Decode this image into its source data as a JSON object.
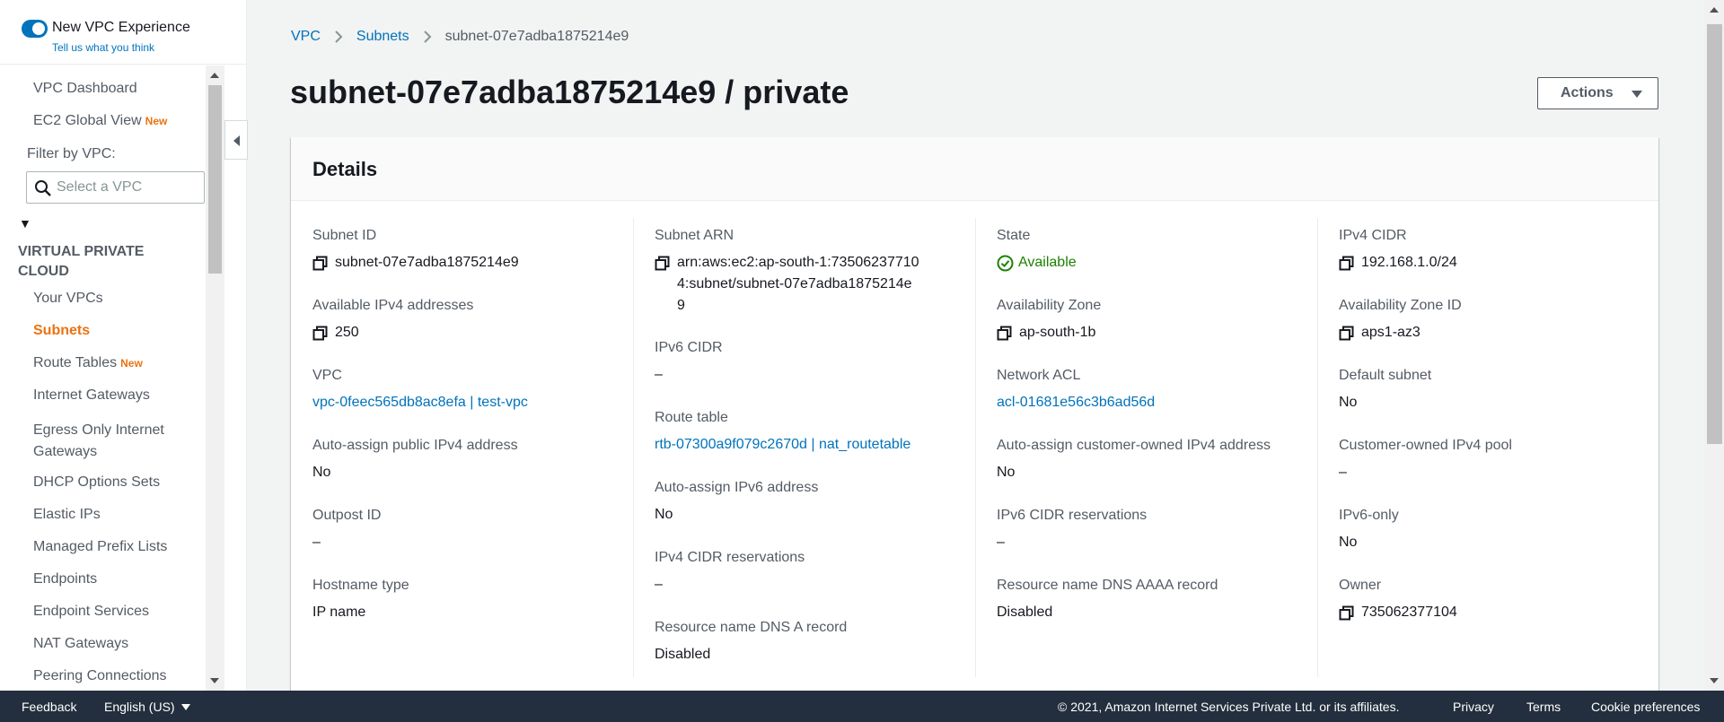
{
  "sidebar": {
    "toggle_label": "New VPC Experience",
    "toggle_sub": "Tell us what you think",
    "top_links": [
      {
        "label": "VPC Dashboard",
        "badge": ""
      },
      {
        "label": "EC2 Global View",
        "badge": "New"
      }
    ],
    "filter_label": "Filter by VPC:",
    "filter_placeholder": "Select a VPC",
    "section_title": "VIRTUAL PRIVATE CLOUD",
    "items": [
      {
        "label": "Your VPCs",
        "badge": ""
      },
      {
        "label": "Subnets",
        "badge": "",
        "active": true
      },
      {
        "label": "Route Tables",
        "badge": "New"
      },
      {
        "label": "Internet Gateways",
        "badge": ""
      },
      {
        "label": "Egress Only Internet Gateways",
        "badge": ""
      },
      {
        "label": "DHCP Options Sets",
        "badge": ""
      },
      {
        "label": "Elastic IPs",
        "badge": ""
      },
      {
        "label": "Managed Prefix Lists",
        "badge": ""
      },
      {
        "label": "Endpoints",
        "badge": ""
      },
      {
        "label": "Endpoint Services",
        "badge": ""
      },
      {
        "label": "NAT Gateways",
        "badge": ""
      },
      {
        "label": "Peering Connections",
        "badge": ""
      }
    ]
  },
  "breadcrumb": [
    "VPC",
    "Subnets",
    "subnet-07e7adba1875214e9"
  ],
  "page_title": "subnet-07e7adba1875214e9 / private",
  "actions_label": "Actions",
  "details": {
    "title": "Details",
    "columns": [
      [
        {
          "label": "Subnet ID",
          "value": "subnet-07e7adba1875214e9",
          "kind": "copy"
        },
        {
          "label": "Available IPv4 addresses",
          "value": "250",
          "kind": "copy"
        },
        {
          "label": "VPC",
          "value": "vpc-0feec565db8ac8efa | test-vpc",
          "kind": "link"
        },
        {
          "label": "Auto-assign public IPv4 address",
          "value": "No",
          "kind": "text"
        },
        {
          "label": "Outpost ID",
          "value": "–",
          "kind": "text"
        },
        {
          "label": "Hostname type",
          "value": "IP name",
          "kind": "text"
        }
      ],
      [
        {
          "label": "Subnet ARN",
          "value": "arn:aws:ec2:ap-south-1:735062377104:subnet/subnet-07e7adba1875214e9",
          "kind": "copy"
        },
        {
          "label": "IPv6 CIDR",
          "value": "–",
          "kind": "text"
        },
        {
          "label": "Route table",
          "value": "rtb-07300a9f079c2670d | nat_routetable",
          "kind": "link"
        },
        {
          "label": "Auto-assign IPv6 address",
          "value": "No",
          "kind": "text"
        },
        {
          "label": "IPv4 CIDR reservations",
          "value": "–",
          "kind": "text"
        },
        {
          "label": "Resource name DNS A record",
          "value": "Disabled",
          "kind": "text"
        }
      ],
      [
        {
          "label": "State",
          "value": "Available",
          "kind": "ok"
        },
        {
          "label": "Availability Zone",
          "value": "ap-south-1b",
          "kind": "copy"
        },
        {
          "label": "Network ACL",
          "value": "acl-01681e56c3b6ad56d",
          "kind": "link"
        },
        {
          "label": "Auto-assign customer-owned IPv4 address",
          "value": "No",
          "kind": "text"
        },
        {
          "label": "IPv6 CIDR reservations",
          "value": "–",
          "kind": "text"
        },
        {
          "label": "Resource name DNS AAAA record",
          "value": "Disabled",
          "kind": "text"
        }
      ],
      [
        {
          "label": "IPv4 CIDR",
          "value": "192.168.1.0/24",
          "kind": "copy"
        },
        {
          "label": "Availability Zone ID",
          "value": "aps1-az3",
          "kind": "copy"
        },
        {
          "label": "Default subnet",
          "value": "No",
          "kind": "text"
        },
        {
          "label": "Customer-owned IPv4 pool",
          "value": "–",
          "kind": "text"
        },
        {
          "label": "IPv6-only",
          "value": "No",
          "kind": "text"
        },
        {
          "label": "Owner",
          "value": "735062377104",
          "kind": "copy"
        }
      ]
    ]
  },
  "footer": {
    "feedback": "Feedback",
    "language": "English (US)",
    "copyright": "© 2021, Amazon Internet Services Private Ltd. or its affiliates.",
    "privacy": "Privacy",
    "terms": "Terms",
    "cookies": "Cookie preferences"
  },
  "colors": {
    "link": "#0073bb",
    "active_nav": "#ec7211",
    "available": "#1d8102",
    "footer_bg": "#232f3e"
  }
}
